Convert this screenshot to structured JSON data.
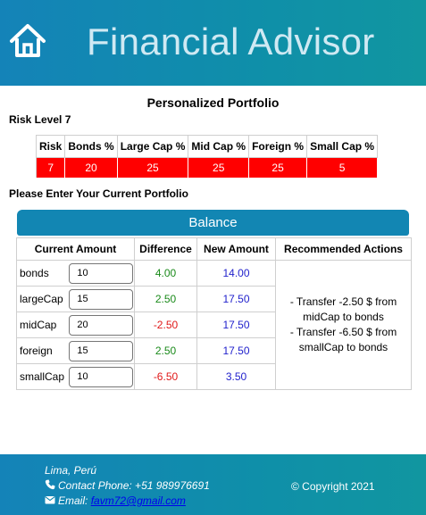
{
  "header": {
    "title": "Financial Advisor",
    "home_icon": "home-icon"
  },
  "page": {
    "title": "Personalized Portfolio",
    "risk_level_label": "Risk Level 7",
    "enter_label": "Please Enter Your Current Portfolio",
    "balance_button": "Balance"
  },
  "risk_table": {
    "headers": [
      "Risk",
      "Bonds %",
      "Large Cap %",
      "Mid Cap %",
      "Foreign %",
      "Small Cap %"
    ],
    "values": [
      "7",
      "20",
      "25",
      "25",
      "25",
      "5"
    ]
  },
  "portfolio": {
    "headers": [
      "Current Amount",
      "Difference",
      "New Amount",
      "Recommended Actions"
    ],
    "rows": [
      {
        "name": "bonds",
        "amount": "10",
        "difference": "4.00",
        "new_amount": "14.00"
      },
      {
        "name": "largeCap",
        "amount": "15",
        "difference": "2.50",
        "new_amount": "17.50"
      },
      {
        "name": "midCap",
        "amount": "20",
        "difference": "-2.50",
        "new_amount": "17.50"
      },
      {
        "name": "foreign",
        "amount": "15",
        "difference": "2.50",
        "new_amount": "17.50"
      },
      {
        "name": "smallCap",
        "amount": "10",
        "difference": "-6.50",
        "new_amount": "3.50"
      }
    ],
    "actions": [
      "- Transfer -2.50 $ from midCap to bonds",
      "- Transfer -6.50 $ from smallCap to bonds"
    ]
  },
  "footer": {
    "location": "Lima, Perú",
    "phone_label": "Contact Phone: +51 989976691",
    "email_label": "Email:",
    "email": "favm72@gmail.com",
    "copyright": "© Copyright 2021"
  },
  "colors": {
    "header_bg": "#1483b8",
    "risk_value_bg": "#ff0000",
    "positive": "#1a8a1a",
    "negative": "#e01818",
    "new_amount": "#2222cc"
  }
}
